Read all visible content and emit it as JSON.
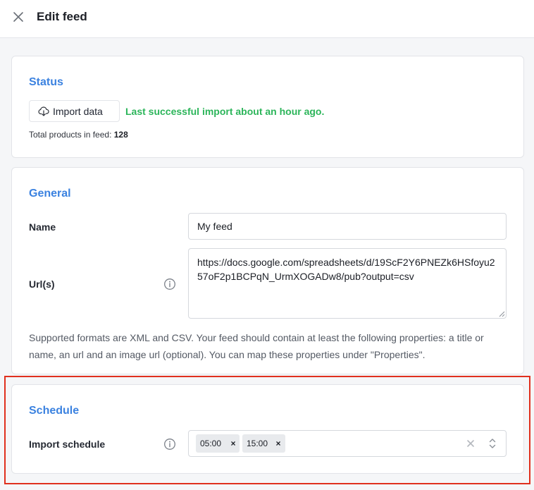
{
  "header": {
    "title": "Edit feed",
    "close_icon": "close-icon"
  },
  "status": {
    "title": "Status",
    "import_button_label": "Import data",
    "import_button_icon": "cloud-download-icon",
    "last_import_text": "Last successful import about an hour ago.",
    "total_label": "Total products in feed:",
    "total_value": "128"
  },
  "general": {
    "title": "General",
    "name_label": "Name",
    "name_value": "My feed",
    "url_label": "Url(s)",
    "url_value": "https://docs.google.com/spreadsheets/d/19ScF2Y6PNEZk6HSfoyu257oF2p1BCPqN_UrmXOGADw8/pub?output=csv",
    "help_text": "Supported formats are XML and CSV. Your feed should contain at least the following properties: a title or name, an url and an image url (optional). You can map these properties under \"Properties\"."
  },
  "schedule": {
    "title": "Schedule",
    "import_schedule_label": "Import schedule",
    "selected_times": [
      "05:00",
      "15:00"
    ]
  },
  "colors": {
    "accent": "#3b82e0",
    "success": "#2cb55a",
    "highlight": "#e0301e"
  }
}
